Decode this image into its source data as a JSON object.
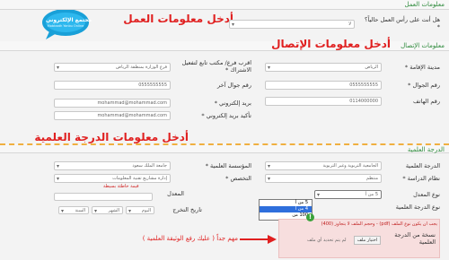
{
  "logo": {
    "brand": "مجتمع الإلكتروني",
    "sub": "Mobtaath Yanbu Online"
  },
  "work": {
    "section_title": "معلومات العمل",
    "annotation": "أدخل معلومات العمل",
    "q_label": "هل أنت على رأس العمل حالياً؟ *",
    "q_value": "لا"
  },
  "contact": {
    "section_title": "معلومات الإتصال",
    "annotation": "أدخل معلومات الإتصال",
    "fields": {
      "city_label": "مدينة الإقامة *",
      "city_value": "الرياض",
      "office_label": "اقرب فرع/ مكتب تابع لتفعيل الاشتراك *",
      "office_value": "فرع الوزارة بمنطقة الرياض",
      "mobile_label": "رقم الجوال *",
      "mobile_value": "0555555555",
      "mobile2_label": "رقم جوال آخر",
      "mobile2_value": "0555555555",
      "phone_label": "رقم الهاتف",
      "phone_value": "0114000000",
      "email_label": "بريد إلكتروني *",
      "email_value": "mohammad@mohammad.com",
      "email2_label": "تأكيد بريد إلكتروني *",
      "email2_value": "mohammad@mohammad.com"
    }
  },
  "degree": {
    "section_title": "الدرجة العلمية",
    "annotation": "أدخل معلومات الدرجة العلمية",
    "fields": {
      "degree_label": "الدرجة العلمية",
      "degree_value": "الجامعية التربوية وغير التربوية",
      "institution_label": "المؤسسة العلمية *",
      "institution_value": "جامعة الملك سعود",
      "system_label": "نظام الدراسة *",
      "system_value": "منتظم",
      "major_label": "التخصص *",
      "major_value": "إدارة مشاريع تقنية المعلومات",
      "gpa_type_label": "نوع المعدل",
      "gpa_type_value": "5 من أ",
      "gpa_label": "المعدل",
      "gpa_hint": "قيمة خاطئة بسيطة",
      "grad_date_label": "تاريخ التخرج",
      "day_value": "اليوم",
      "month_value": "الشهر",
      "year_value": "السنة",
      "grade_type_label": "نوع الدرجة العلمية"
    },
    "gpa_options": [
      "5 من أ",
      "4 من أ",
      "100 من"
    ],
    "gpa_selected_index": 1
  },
  "upload": {
    "marker": "!",
    "warning": "يجب أن يكون نوع الملف (pdf) - وحجم الملف لا يتجاوز (400)",
    "file_label": "نسخة من الدرجة العلمية",
    "choose_button": "اختيار ملف",
    "no_file_text": "لم يتم تحديد أي ملف"
  },
  "important": {
    "text": "مهم جداً ( عليك رفع الوثيقة العلمية )"
  },
  "colors": {
    "annotation_red": "#e02020",
    "section_green": "#2d8a3b",
    "highlight_blue": "#2f6fdc",
    "warning_pink": "#f7dede",
    "logo_blue": "#19a0d8"
  }
}
